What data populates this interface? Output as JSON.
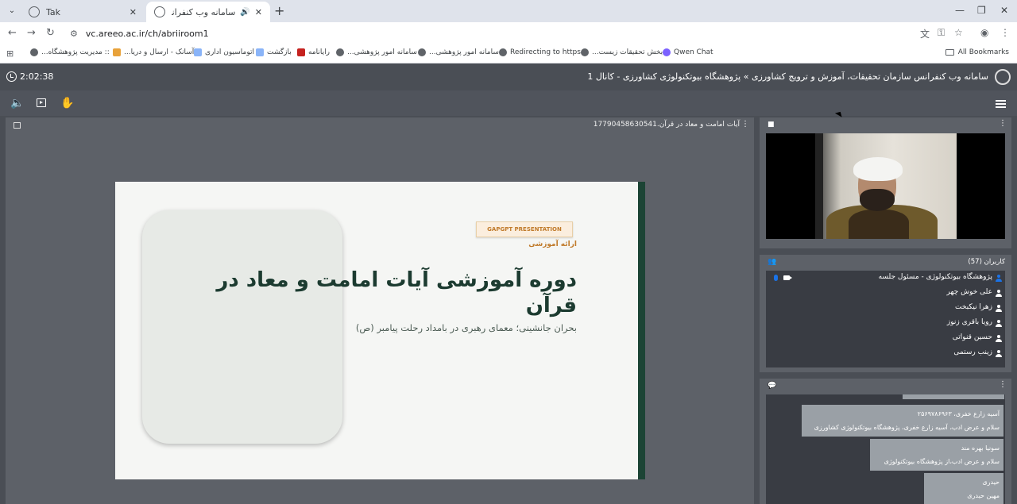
{
  "browser": {
    "tabs": [
      {
        "title": "Tak"
      },
      {
        "title": "سامانه وب کنفرانس سازمان"
      }
    ],
    "url": "vc.areeo.ac.ir/ch/abriiroom1",
    "bookmarks": [
      ":: مدیریت پژوهشگاه...",
      "آسانک - ارسال و دریا...",
      "اتوماسیون اداری",
      "بازگشت",
      "رایانامه",
      "سامانه امور پژوهشی...",
      "سامانه امور پژوهشی...",
      "Redirecting to https...",
      "بخش تحقیقات زیست...",
      "Qwen Chat"
    ],
    "all_bookmarks": "All Bookmarks"
  },
  "conference": {
    "timer": "2:02:38",
    "title": "سامانه وب کنفرانس سازمان تحقیقات، آموزش و ترویج کشاورزی » پژوهشگاه بیوتکنولوژی کشاورزی - کانال 1"
  },
  "presentation": {
    "file_name": "آیات امامت و معاد در قرآن.17790458630541",
    "badge": "GAPGPT PRESENTATION",
    "kicker": "ارائه آموزشی",
    "title": "دوره آموزشی آیات امامت و معاد در قرآن",
    "subtitle": "بحران جانشینی؛ معمای رهبری در بامداد رحلت پیامبر (ص)"
  },
  "users": {
    "title": "کاربران (57)",
    "list": [
      {
        "name": "پژوهشگاه بیوتکنولوژی - مسئول جلسه",
        "presenter": true
      },
      {
        "name": "علی خوش چهر",
        "presenter": false
      },
      {
        "name": "زهرا نیکبخت",
        "presenter": false
      },
      {
        "name": "رویا باقری زنوز",
        "presenter": false
      },
      {
        "name": "حسین قنواتی",
        "presenter": false
      },
      {
        "name": "زینب رستمی",
        "presenter": false
      }
    ]
  },
  "chat": {
    "messages": [
      {
        "sender": "آسیه زارع خفری، ۲۵۶۹۷۸۶۹۶۳",
        "text": "سلام و عرض ادب، آسیه زارع خفری، پژوهشگاه بیوتکنولوژی کشاورزی"
      },
      {
        "sender": "سونیا بهره مند",
        "text": "سلام و عرض ادب،از پژوهشگاه بیوتکنولوژی"
      },
      {
        "sender": "حیدری",
        "text": "مهین حیدری"
      }
    ]
  },
  "colors": {
    "slide_accent": "#1c4435",
    "badge_text": "#c07a2a",
    "presenter_blue": "#1a73e8"
  }
}
